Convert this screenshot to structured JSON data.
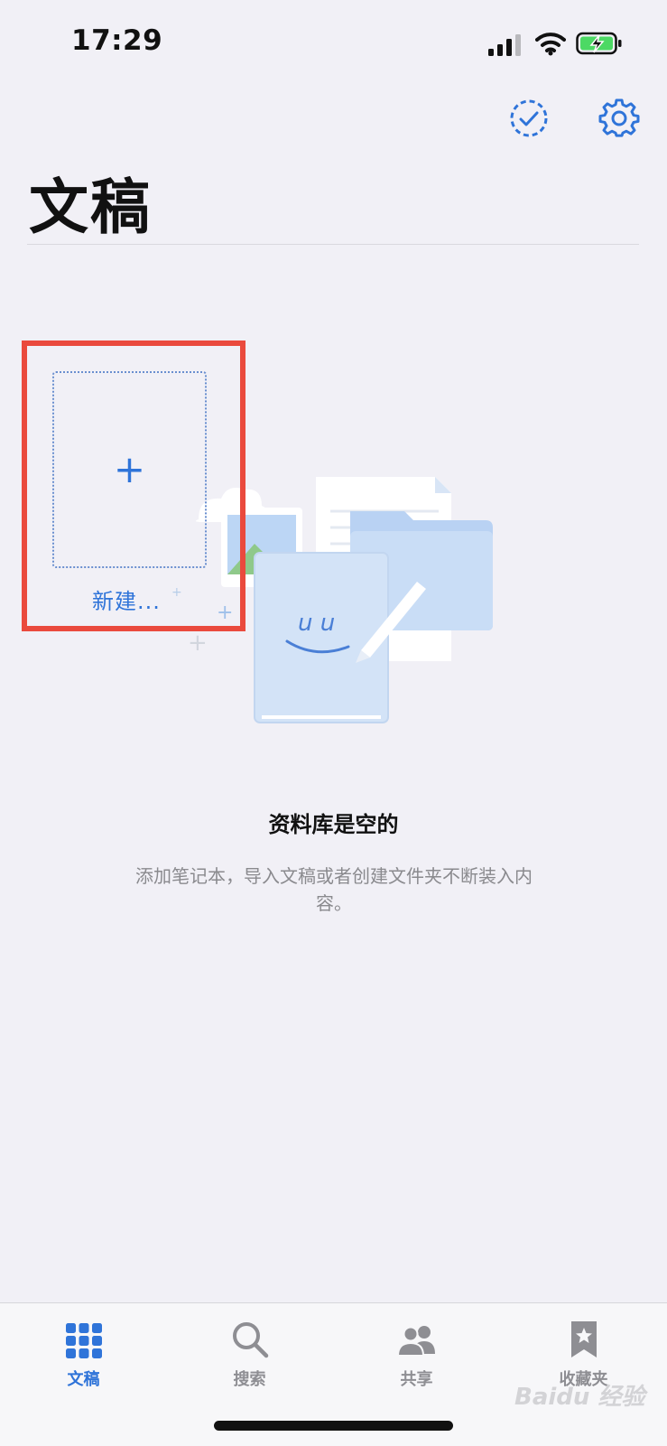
{
  "status_bar": {
    "time": "17:29"
  },
  "header": {
    "title": "文稿",
    "select_icon": "dashed-checkmark-circle",
    "settings_icon": "gear"
  },
  "new_document": {
    "plus": "+",
    "label": "新建..."
  },
  "empty_state": {
    "title": "资料库是空的",
    "description": "添加笔记本，导入文稿或者创建文件夹不断装入内容。"
  },
  "tabs": [
    {
      "label": "文稿",
      "icon": "grid",
      "active": true
    },
    {
      "label": "搜索",
      "icon": "magnifier",
      "active": false
    },
    {
      "label": "共享",
      "icon": "people",
      "active": false
    },
    {
      "label": "收藏夹",
      "icon": "bookmark-star",
      "active": false
    }
  ],
  "watermark": "Baidu 经验",
  "colors": {
    "accent": "#2f74d9",
    "highlight": "#ea4a3d",
    "background": "#f1f0f6"
  }
}
